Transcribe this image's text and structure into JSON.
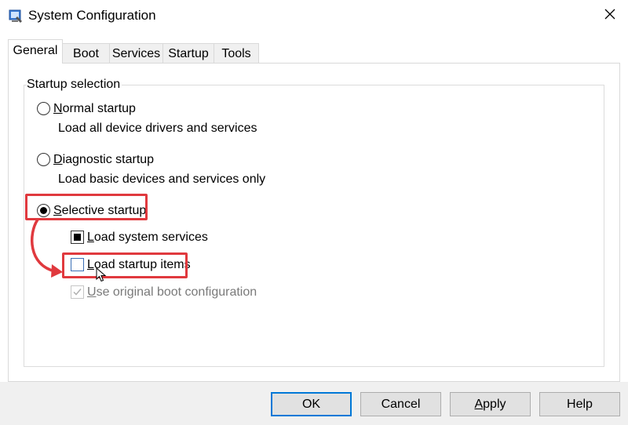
{
  "window": {
    "title": "System Configuration",
    "icon": "msconfig-icon",
    "close_icon": "close-icon"
  },
  "tabs": [
    {
      "label": "General",
      "active": true
    },
    {
      "label": "Boot",
      "active": false
    },
    {
      "label": "Services",
      "active": false
    },
    {
      "label": "Startup",
      "active": false
    },
    {
      "label": "Tools",
      "active": false
    }
  ],
  "startup_selection": {
    "group_title": "Startup selection",
    "normal": {
      "label_first": "N",
      "label_rest": "ormal startup",
      "description": "Load all device drivers and services",
      "selected": false
    },
    "diagnostic": {
      "label_first": "D",
      "label_rest": "iagnostic startup",
      "description": "Load basic devices and services only",
      "selected": false
    },
    "selective": {
      "label_first": "S",
      "label_rest": "elective startup",
      "selected": true
    },
    "load_system_services": {
      "label_first": "L",
      "label_rest": "oad system services",
      "checked": "indeterminate"
    },
    "load_startup_items": {
      "label_first": "L",
      "label_rest": "oad startup items",
      "checked": false
    },
    "use_original_boot": {
      "label_first": "U",
      "label_rest": "se original boot configuration",
      "checked": true,
      "enabled": false
    }
  },
  "annotation": {
    "highlight_color": "#e0393e"
  },
  "buttons": {
    "ok": "OK",
    "cancel": "Cancel",
    "apply_first": "A",
    "apply_rest": "pply",
    "help": "Help"
  }
}
